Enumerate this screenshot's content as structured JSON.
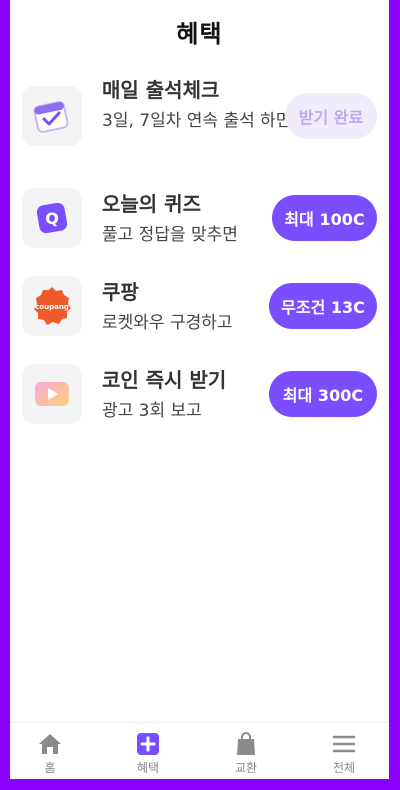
{
  "header": {
    "title": "혜택"
  },
  "rewards": [
    {
      "title": "매일 출석체크",
      "desc": "3일, 7일차 연속 출석 하면",
      "button": "받기 완료",
      "icon": "calendar-check-icon"
    },
    {
      "title": "오늘의 퀴즈",
      "desc": "풀고 정답을 맞추면",
      "button": "최대 100C",
      "icon": "quiz-q-icon"
    },
    {
      "title": "쿠팡",
      "desc": "로켓와우 구경하고",
      "button": "무조건 13C",
      "icon": "coupang-logo",
      "logo_text": "coupang"
    },
    {
      "title": "코인 즉시 받기",
      "desc": "광고 3회 보고",
      "button": "최대 300C",
      "icon": "video-play-icon"
    }
  ],
  "tabs": [
    {
      "label": "홈",
      "icon": "home-icon"
    },
    {
      "label": "혜택",
      "icon": "plus-square-icon"
    },
    {
      "label": "교환",
      "icon": "shopping-bag-icon"
    },
    {
      "label": "전체",
      "icon": "menu-icon"
    }
  ],
  "colors": {
    "accent": "#7A4DFF",
    "done_bg": "#F0ECFB",
    "done_text": "#BCA9EE",
    "frame": "#8B00FF"
  }
}
